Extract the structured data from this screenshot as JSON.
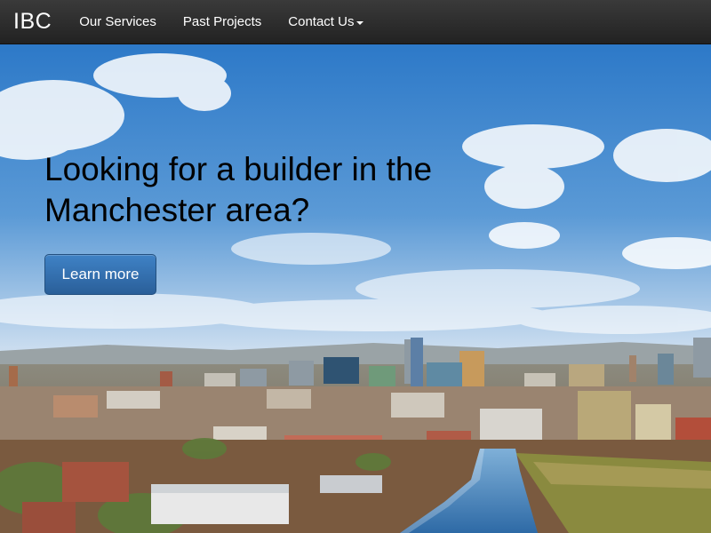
{
  "navbar": {
    "brand": "IBC",
    "items": [
      {
        "label": "Our Services"
      },
      {
        "label": "Past Projects"
      },
      {
        "label": "Contact Us"
      }
    ]
  },
  "hero": {
    "headline": "Looking for a builder in the Manchester area?",
    "button_label": "Learn more",
    "background_image": "manchester-city-skyline-photo"
  },
  "colors": {
    "navbar": "#2b2b2b",
    "button": "#337ab7",
    "sky": "#6fa8d6"
  }
}
